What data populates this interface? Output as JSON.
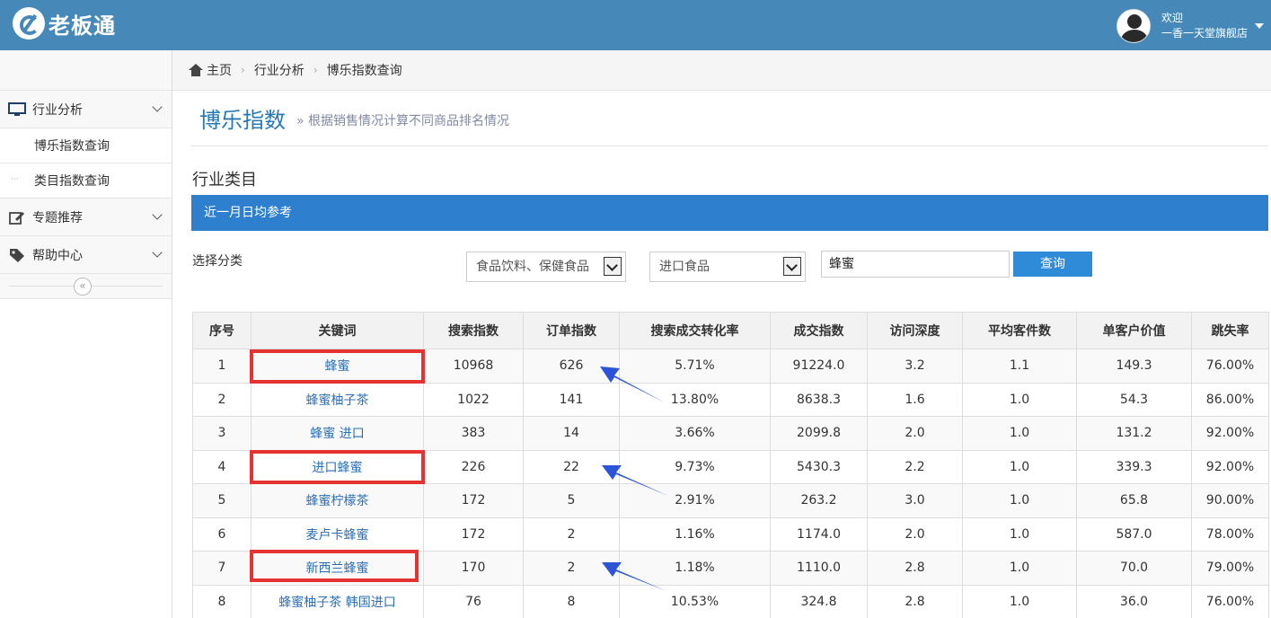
{
  "header": {
    "logo_text": "老板通",
    "welcome": "欢迎",
    "shop_name": "一香一天堂旗舰店"
  },
  "sidebar": {
    "items": [
      {
        "label": "行业分析",
        "icon": "monitor-icon"
      },
      {
        "label": "专题推荐",
        "icon": "edit-icon"
      },
      {
        "label": "帮助中心",
        "icon": "tag-icon"
      }
    ],
    "sub_items": [
      {
        "label": "博乐指数查询"
      },
      {
        "label": "类目指数查询"
      }
    ],
    "collapse_symbol": "«"
  },
  "breadcrumb": {
    "items": [
      "主页",
      "行业分析",
      "博乐指数查询"
    ]
  },
  "page": {
    "title": "博乐指数",
    "subtitle": "» 根据销售情况计算不同商品排名情况",
    "section_title": "行业类目",
    "bar_text": "近一月日均参考"
  },
  "filter": {
    "label": "选择分类",
    "category1": "食品饮料、保健食品",
    "category2": "进口食品",
    "search_value": "蜂蜜",
    "query_button": "查询"
  },
  "table": {
    "headers": [
      "序号",
      "关键词",
      "搜索指数",
      "订单指数",
      "搜索成交转化率",
      "成交指数",
      "访问深度",
      "平均客件数",
      "单客户价值",
      "跳失率"
    ],
    "rows": [
      [
        "1",
        "蜂蜜",
        "10968",
        "626",
        "5.71%",
        "91224.0",
        "3.2",
        "1.1",
        "149.3",
        "76.00%"
      ],
      [
        "2",
        "蜂蜜柚子茶",
        "1022",
        "141",
        "13.80%",
        "8638.3",
        "1.6",
        "1.0",
        "54.3",
        "86.00%"
      ],
      [
        "3",
        "蜂蜜 进口",
        "383",
        "14",
        "3.66%",
        "2099.8",
        "2.0",
        "1.0",
        "131.2",
        "92.00%"
      ],
      [
        "4",
        "进口蜂蜜",
        "226",
        "22",
        "9.73%",
        "5430.3",
        "2.2",
        "1.0",
        "339.3",
        "92.00%"
      ],
      [
        "5",
        "蜂蜜柠檬茶",
        "172",
        "5",
        "2.91%",
        "263.2",
        "3.0",
        "1.0",
        "65.8",
        "90.00%"
      ],
      [
        "6",
        "麦卢卡蜂蜜",
        "172",
        "2",
        "1.16%",
        "1174.0",
        "2.0",
        "1.0",
        "587.0",
        "78.00%"
      ],
      [
        "7",
        "新西兰蜂蜜",
        "170",
        "2",
        "1.18%",
        "1110.0",
        "2.8",
        "1.0",
        "70.0",
        "79.00%"
      ],
      [
        "8",
        "蜂蜜柚子茶 韩国进口",
        "76",
        "8",
        "10.53%",
        "324.8",
        "2.8",
        "1.0",
        "36.0",
        "76.00%"
      ]
    ]
  },
  "annotations": {
    "highlight_color": "#e53333",
    "arrow_color": "#2b54d6"
  }
}
